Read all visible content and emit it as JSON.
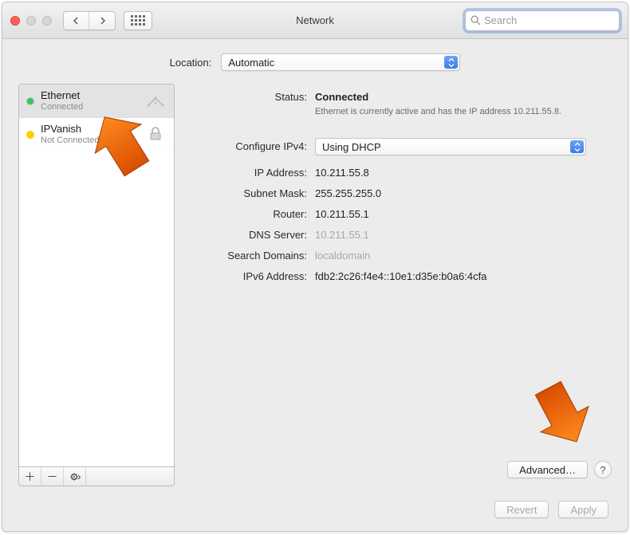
{
  "header": {
    "title": "Network",
    "search_placeholder": "Search"
  },
  "location": {
    "label": "Location:",
    "value": "Automatic"
  },
  "sidebar": {
    "items": [
      {
        "name": "Ethernet",
        "status": "Connected",
        "dot": "green"
      },
      {
        "name": "IPVanish",
        "status": "Not Connected",
        "dot": "amber"
      }
    ]
  },
  "main": {
    "status_label": "Status:",
    "status_value": "Connected",
    "status_sub": "Ethernet is currently active and has the IP address 10.211.55.8.",
    "configure_label": "Configure IPv4:",
    "configure_value": "Using DHCP",
    "fields": {
      "ip_label": "IP Address:",
      "ip_value": "10.211.55.8",
      "subnet_label": "Subnet Mask:",
      "subnet_value": "255.255.255.0",
      "router_label": "Router:",
      "router_value": "10.211.55.1",
      "dns_label": "DNS Server:",
      "dns_value": "10.211.55.1",
      "search_label": "Search Domains:",
      "search_value": "localdomain",
      "ipv6_label": "IPv6 Address:",
      "ipv6_value": "fdb2:2c26:f4e4::10e1:d35e:b0a6:4cfa"
    },
    "advanced_label": "Advanced…"
  },
  "footer": {
    "revert": "Revert",
    "apply": "Apply"
  }
}
